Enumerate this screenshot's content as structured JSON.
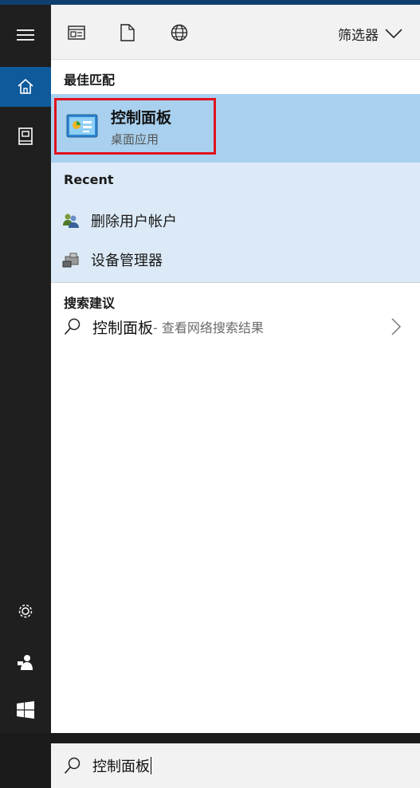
{
  "rail": {
    "items": [
      {
        "name": "menu",
        "icon": "hamburger-icon"
      },
      {
        "name": "home",
        "icon": "home-icon"
      },
      {
        "name": "notebook",
        "icon": "notebook-icon"
      },
      {
        "name": "settings",
        "icon": "gear-icon"
      },
      {
        "name": "feedback",
        "icon": "feedback-icon"
      },
      {
        "name": "start",
        "icon": "windows-logo-icon"
      }
    ]
  },
  "toolbar": {
    "icons": [
      "apps-icon",
      "document-icon",
      "web-globe-icon"
    ],
    "filter_label": "筛选器"
  },
  "best_match": {
    "header": "最佳匹配",
    "title": "控制面板",
    "subtitle": "桌面应用",
    "icon": "control-panel-icon"
  },
  "recent": {
    "header": "Recent",
    "items": [
      {
        "label": "删除用户帐户",
        "icon": "user-accounts-icon"
      },
      {
        "label": "设备管理器",
        "icon": "device-manager-icon"
      }
    ]
  },
  "suggestions": {
    "header": "搜索建议",
    "query": "控制面板",
    "hint": " - 查看网络搜索结果"
  },
  "search": {
    "value": "控制面板"
  },
  "colors": {
    "accent": "#0e5a9b",
    "highlight": "#a9d1ef",
    "recent_bg": "#dbeaf6",
    "border_red": "#e0121c"
  }
}
